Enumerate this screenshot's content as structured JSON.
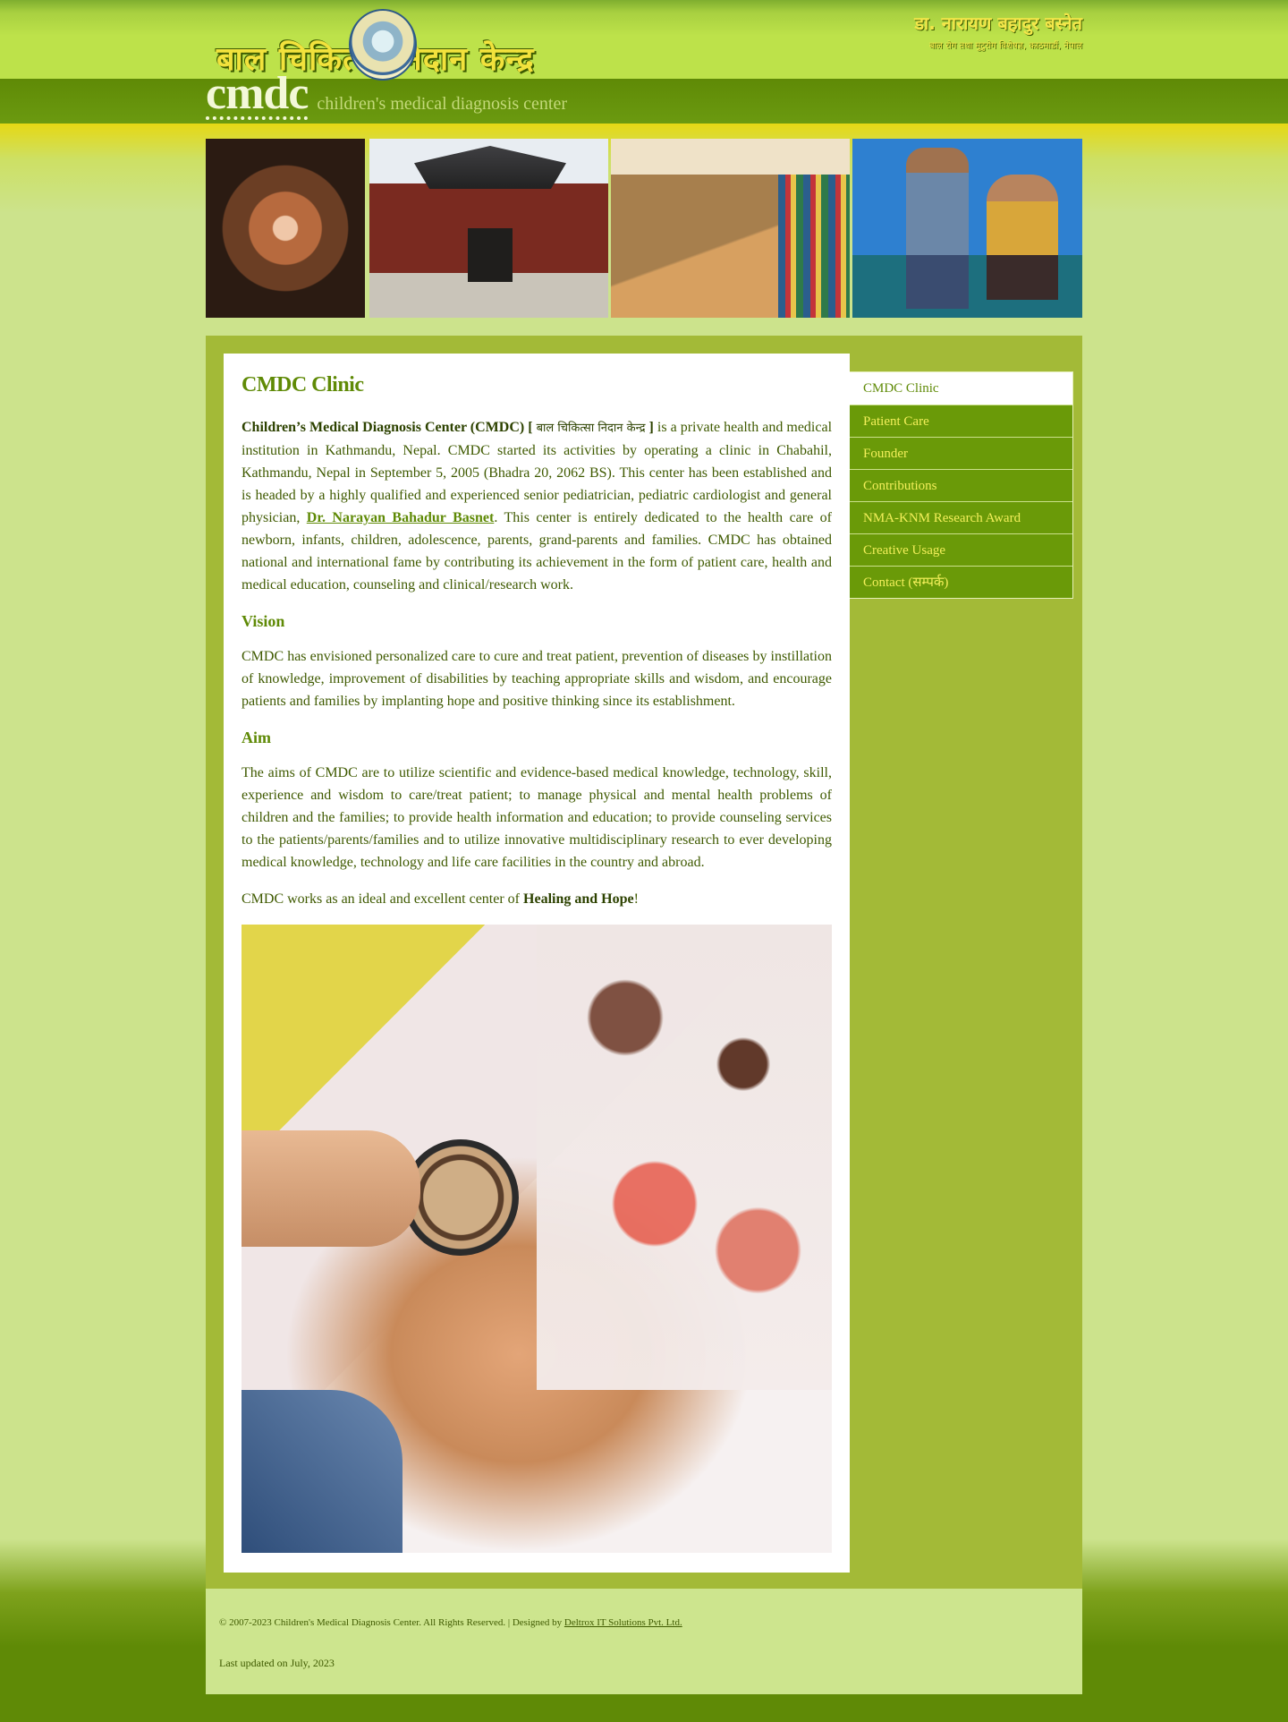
{
  "header": {
    "logo_text": "बाल चिकित्सा निदान केन्द्र",
    "right_name": "डा. नारायण बहादुर बस्नेत",
    "right_sub": "बाल रोग तथा मुटुरोग विशेषज्ञ, काठमाडौं, नेपाल",
    "brand": "cmdc",
    "tagline": "children's medical diagnosis center"
  },
  "content": {
    "title": "CMDC Clinic",
    "intro_bold": "Children’s Medical Diagnosis Center (CMDC) [",
    "intro_devanagari": "बाल चिकित्सा निदान केन्द्र",
    "intro_bracket_close": "]",
    "intro_text_1": " is a private health and medical institution in Kathmandu, Nepal. CMDC started its activities by operating a clinic in Chabahil, Kathmandu, Nepal in September 5, 2005 (Bhadra 20, 2062 BS). This center has been established and is headed by a highly qualified and experienced senior pediatrician, pediatric cardiologist and general physician, ",
    "founder_link": "Dr. Narayan Bahadur Basnet",
    "intro_text_2": ". This center is entirely dedicated to the health care of newborn, infants, children, adolescence, parents, grand-parents and families. CMDC has obtained national and international fame by contributing its achievement in the form of patient care, health and medical education, counseling and clinical/research work.",
    "vision_heading": "Vision",
    "vision_text": "CMDC has envisioned personalized care to cure and treat patient, prevention of diseases by instillation of knowledge, improvement of disabilities by teaching appropriate skills and wisdom, and encourage patients and families by implanting hope and positive thinking since its establishment.",
    "aim_heading": "Aim",
    "aim_text": "The aims of CMDC are to utilize scientific and evidence-based medical knowledge, technology, skill, experience and wisdom to care/treat patient; to manage physical and mental health problems of children and the families; to provide health information and education; to provide counseling services to the patients/parents/families and to utilize innovative multidisciplinary research to ever developing medical knowledge, technology and life care facilities in the country and abroad.",
    "closing_prefix": "CMDC works as an ideal and excellent center of ",
    "closing_bold": "Healing and Hope",
    "closing_suffix": "!"
  },
  "menu": {
    "items": [
      {
        "label": "CMDC Clinic"
      },
      {
        "label": "Patient Care"
      },
      {
        "label": "Founder"
      },
      {
        "label": "Contributions"
      },
      {
        "label": "NMA-KNM Research Award"
      },
      {
        "label": "Creative Usage"
      },
      {
        "label": "Contact (सम्पर्क)"
      }
    ]
  },
  "footer": {
    "copyright": "© 2007-2023 Children's Medical Diagnosis Center. All Rights Reserved. | Designed by ",
    "designer_link": "Deltrox IT Solutions Pvt. Ltd.",
    "updated": "Last updated on July, 2023"
  },
  "colors": {
    "brand_green": "#5f8a06",
    "header_lime": "#bde24a",
    "menu_green": "#6a9a08",
    "menu_text_yellow": "#f3ef5a",
    "page_bg": "#cce38c"
  }
}
